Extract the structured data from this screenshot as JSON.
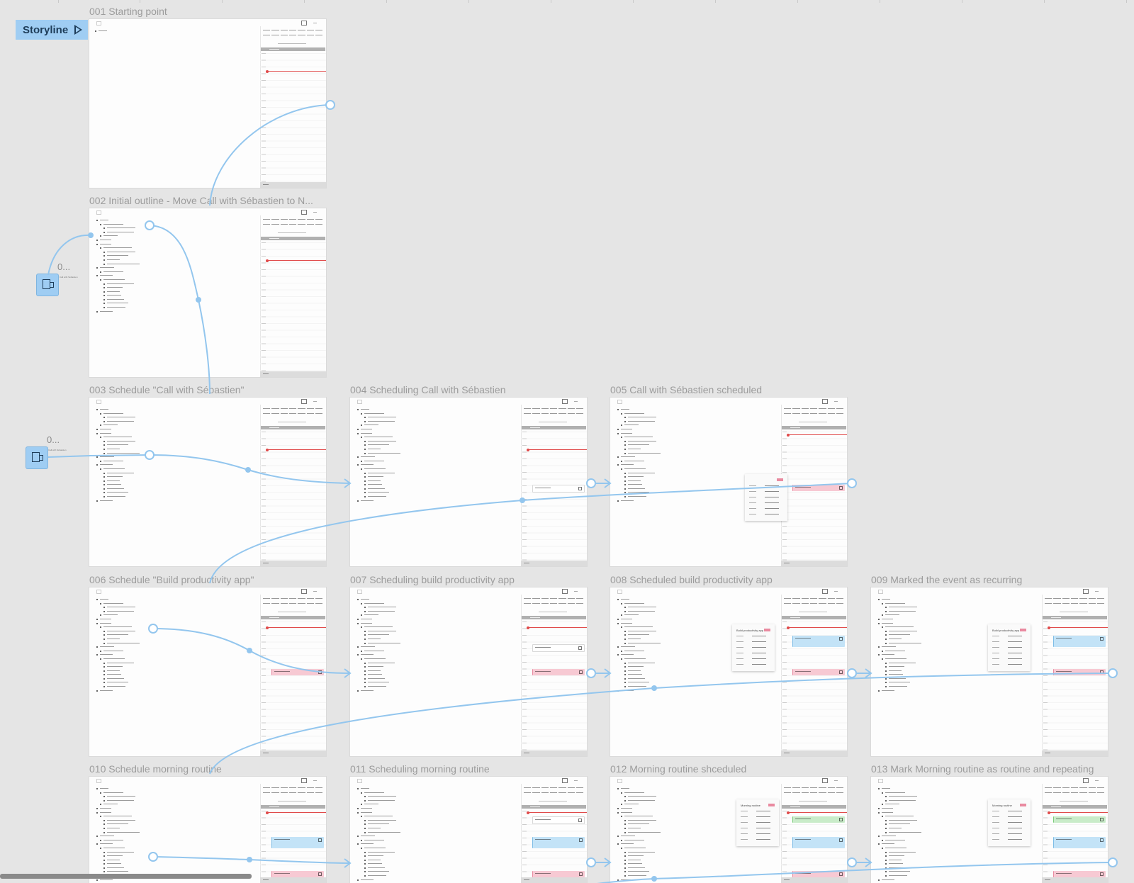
{
  "storyline": {
    "label": "Storyline"
  },
  "flow_nodes": [
    {
      "label": "0...",
      "sublabel": "Call with Sébastien"
    },
    {
      "label": "0...",
      "sublabel": "Call with Sébastien"
    }
  ],
  "frames": [
    {
      "title": "001 Starting point"
    },
    {
      "title": "002 Initial outline - Move Call with Sébastien to N..."
    },
    {
      "title": "003 Schedule \"Call with Sébastien\""
    },
    {
      "title": "004 Scheduling Call with Sébastien"
    },
    {
      "title": "005 Call with Sébastien scheduled"
    },
    {
      "title": "006 Schedule \"Build productivity app\""
    },
    {
      "title": "007 Scheduling build productivity app"
    },
    {
      "title": "008 Scheduled build productivity app"
    },
    {
      "title": "009 Marked the event as recurring"
    },
    {
      "title": "010 Schedule morning routine"
    },
    {
      "title": "011 Scheduling morning routine"
    },
    {
      "title": "012 Morning routine shceduled"
    },
    {
      "title": "013 Mark Morning routine as routine and repeating"
    }
  ],
  "popups": [
    {
      "title": "Build productivity app"
    },
    {
      "title": "Build productivity app"
    },
    {
      "title": "Morning routine"
    },
    {
      "title": "Morning routine"
    }
  ],
  "colors": {
    "accent": "#9fcdf3",
    "link": "#93c6ee",
    "now_line": "#e04a4a",
    "event_pink": "#f7c9d3",
    "event_blue": "#c3e3f7",
    "event_green": "#c9ecc9"
  }
}
